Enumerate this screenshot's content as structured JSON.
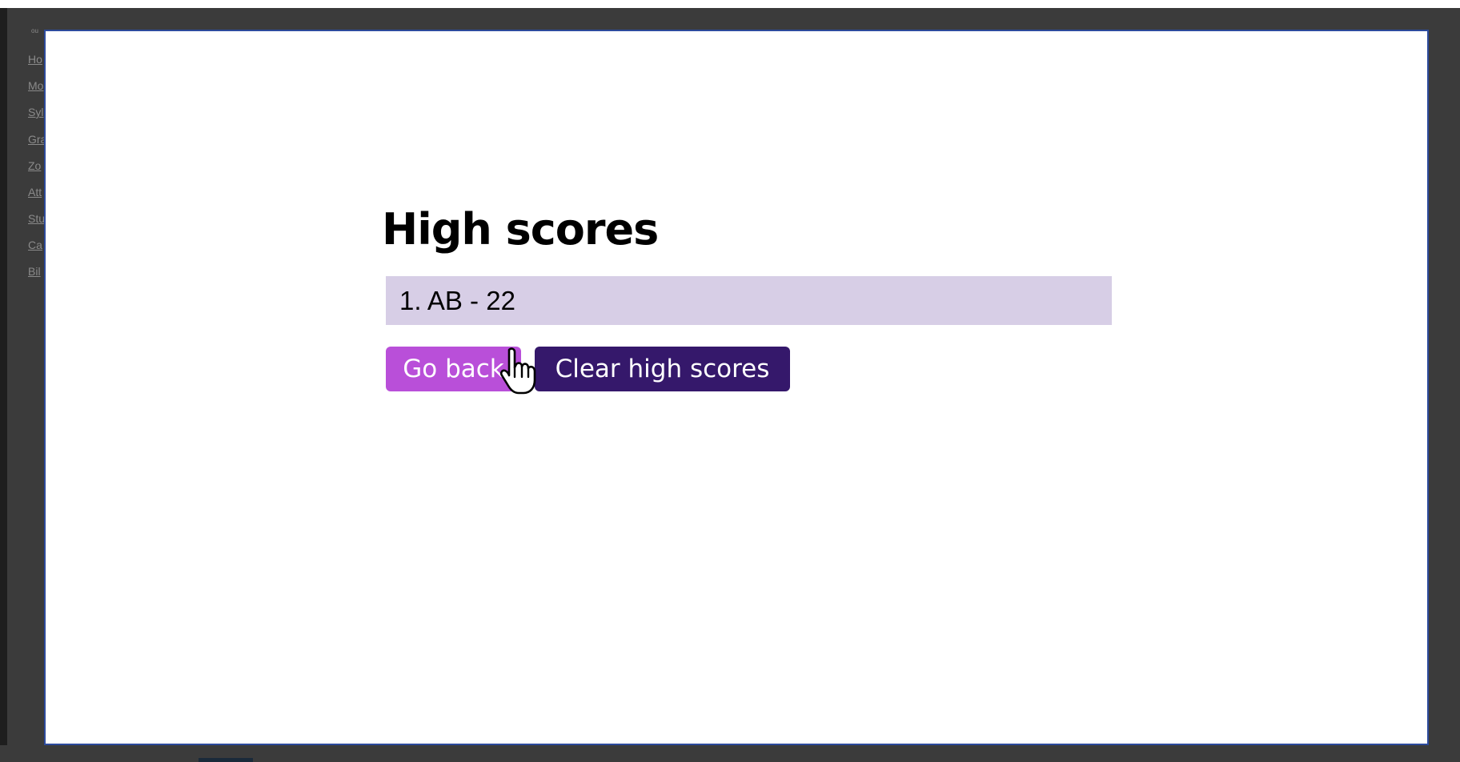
{
  "background_nav": {
    "course_tag": "ou",
    "links": [
      "Ho",
      "Mo",
      "Syl",
      "Gra",
      "Zo",
      "Att",
      "Stu",
      "Ca",
      "Bil"
    ]
  },
  "quiz": {
    "title": "High scores",
    "scores": [
      "1. AB - 22"
    ],
    "go_back_label": "Go back",
    "clear_label": "Clear high scores"
  },
  "colors": {
    "score_row_bg": "#d7cee6",
    "go_back_bg": "#b94fd9",
    "clear_bg": "#35186b",
    "modal_border": "#2c4a9c"
  },
  "cursor": {
    "icon": "hand-pointer-icon"
  }
}
